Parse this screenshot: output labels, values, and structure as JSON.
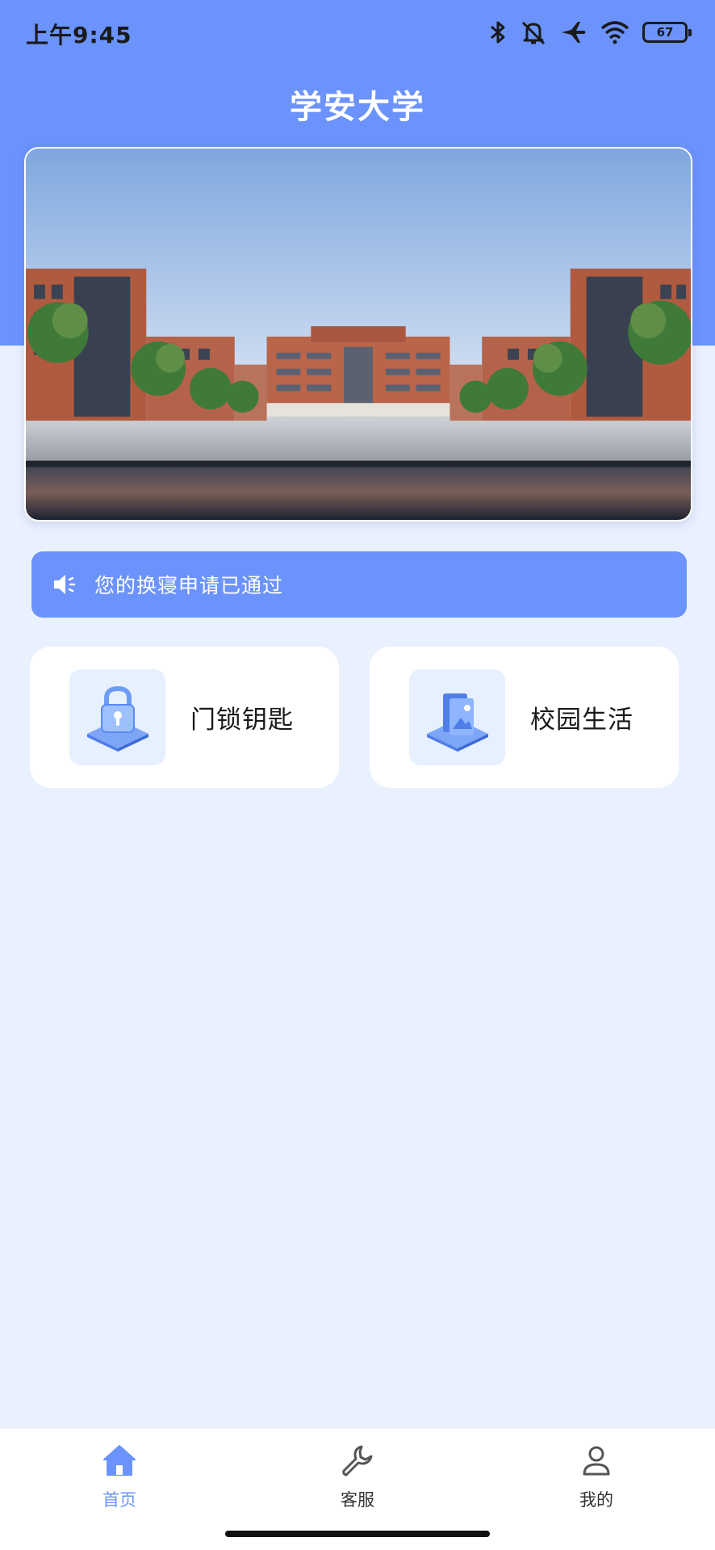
{
  "status_bar": {
    "time": "上午9:45",
    "battery": "67",
    "icons": [
      "bluetooth-icon",
      "mute-icon",
      "airplane-icon",
      "wifi-icon",
      "battery-icon"
    ]
  },
  "header": {
    "title": "学安大学"
  },
  "banner": {
    "image": "campus-buildings-photo"
  },
  "notice": {
    "icon": "speaker-icon",
    "text": "您的换寝申请已通过"
  },
  "cards": [
    {
      "icon": "lock-icon",
      "label": "门锁钥匙"
    },
    {
      "icon": "campus-life-icon",
      "label": "校园生活"
    }
  ],
  "bottom_nav": {
    "items": [
      {
        "icon": "home-icon",
        "label": "首页",
        "active": true
      },
      {
        "icon": "wrench-icon",
        "label": "客服",
        "active": false
      },
      {
        "icon": "user-icon",
        "label": "我的",
        "active": false
      }
    ]
  },
  "colors": {
    "primary": "#6b93fb",
    "page_bg": "#eaf1fe",
    "card_bg": "#ffffff",
    "icon_tile": "#e6f0ff"
  }
}
